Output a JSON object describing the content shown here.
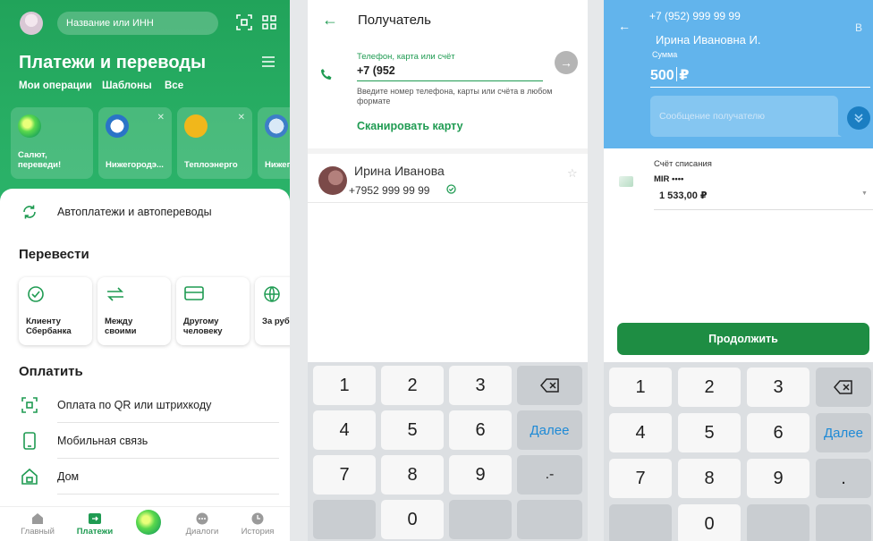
{
  "screen1": {
    "search_placeholder": "Название или ИНН",
    "title": "Платежи и переводы",
    "subnav": [
      "Мои операции",
      "Шаблоны",
      "Все"
    ],
    "quick": [
      {
        "label": "Салют,\nпереведи!"
      },
      {
        "label": "Нижегородэ..."
      },
      {
        "label": "Теплоэнерго"
      },
      {
        "label": "Нижег"
      }
    ],
    "autopay": "Автоплатежи и автопереводы",
    "transfer_title": "Перевести",
    "transfers": [
      {
        "label": "Клиенту\nСбербанка",
        "icon": "check-circle-icon"
      },
      {
        "label": "Между\nсвоими",
        "icon": "swap-icon"
      },
      {
        "label": "Другому\nчеловеку",
        "icon": "card-icon"
      },
      {
        "label": "За руб",
        "icon": "globe-icon"
      }
    ],
    "pay_title": "Оплатить",
    "pay_items": [
      {
        "label": "Оплата по QR или штрихкоду",
        "icon": "qr-icon"
      },
      {
        "label": "Мобильная связь",
        "icon": "mobile-icon"
      },
      {
        "label": "Дом",
        "icon": "home-icon"
      }
    ],
    "tabs": [
      "Главный",
      "Платежи",
      "",
      "Диалоги",
      "История"
    ],
    "accent": "#21a35a"
  },
  "screen2": {
    "title": "Получатель",
    "field_label": "Телефон, карта или счёт",
    "field_value": "+7 (952",
    "field_help": "Введите номер телефона, карты или счёта в любом формате",
    "scan": "Сканировать карту",
    "contact_name": "Ирина Иванова",
    "contact_phone": "+7952 999 99 99"
  },
  "screen3": {
    "phone": "+7 (952) 999 99 99",
    "name": "Ирина Ивановна И.",
    "amount_label": "Сумма",
    "amount": "500",
    "currency": "₽",
    "message_placeholder": "Сообщение получателю",
    "account_label": "Счёт списания",
    "card_name": "MIR ••••",
    "balance": "1 533,00 ₽",
    "continue": "Продолжить",
    "badge": "B"
  },
  "keypad": {
    "keys": [
      "1",
      "2",
      "3",
      "4",
      "5",
      "6",
      "7",
      "8",
      "9",
      "0"
    ],
    "next": "Далее",
    "dot2": ".-",
    "dot3": "."
  }
}
